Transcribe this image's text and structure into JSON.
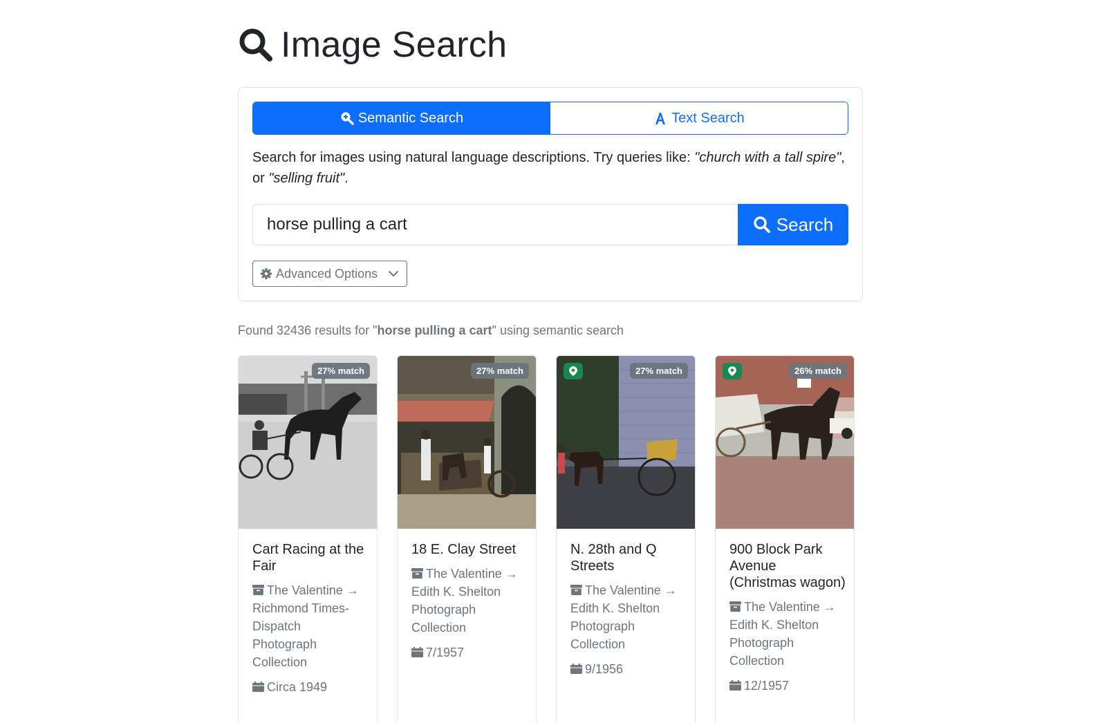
{
  "header": {
    "title": "Image Search",
    "icon": "search-icon"
  },
  "search_panel": {
    "modes": [
      {
        "label": "Semantic Search",
        "icon": "semantic-search-icon",
        "active": true
      },
      {
        "label": "Text Search",
        "icon": "text-icon",
        "active": false
      }
    ],
    "help_prefix": "Search for images using natural language descriptions. Try queries like: ",
    "help_example_1": "\"church with a tall spire\"",
    "help_middle": ", or ",
    "help_example_2": "\"selling fruit\"",
    "help_suffix": ".",
    "query_value": "horse pulling a cart",
    "search_button_label": "Search",
    "advanced_options_label": "Advanced Options"
  },
  "results": {
    "prefix": "Found 32436 results for \"",
    "query": "horse pulling a cart",
    "suffix": "\" using semantic search"
  },
  "cards": [
    {
      "match": "27% match",
      "has_location": false,
      "title": "Cart Racing at the Fair",
      "source": "The Valentine → Richmond Times-Dispatch Photograph Collection",
      "date": "Circa 1949"
    },
    {
      "match": "27% match",
      "has_location": false,
      "title": "18 E. Clay Street",
      "source": "The Valentine → Edith K. Shelton Photograph Collection",
      "date": "7/1957"
    },
    {
      "match": "27% match",
      "has_location": true,
      "title": "N. 28th and Q Streets",
      "source": "The Valentine → Edith K. Shelton Photograph Collection",
      "date": "9/1956"
    },
    {
      "match": "26% match",
      "has_location": true,
      "title": "900 Block Park Avenue (Christmas wagon)",
      "source": "The Valentine → Edith K. Shelton Photograph Collection",
      "date": "12/1957"
    }
  ],
  "colors": {
    "primary": "#0d6efd",
    "muted": "#6c757d",
    "location_badge": "#198754"
  }
}
